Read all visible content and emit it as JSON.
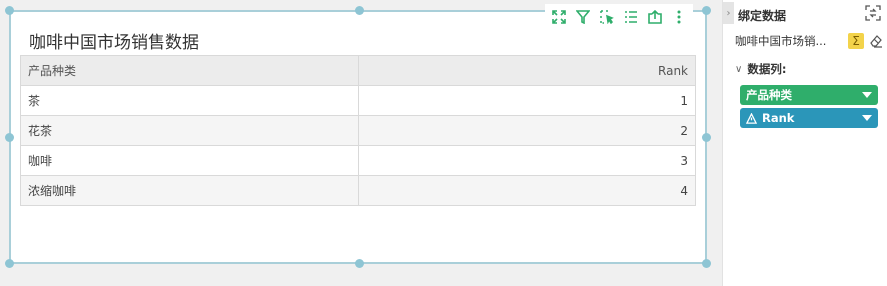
{
  "widget": {
    "title": "咖啡中国市场销售数据",
    "toolbar_icons": [
      "expand-icon",
      "filter-icon",
      "select-icon",
      "list-icon",
      "export-icon",
      "more-icon"
    ]
  },
  "table": {
    "columns": [
      "产品种类",
      "Rank"
    ],
    "rows": [
      [
        "茶",
        "1"
      ],
      [
        "花茶",
        "2"
      ],
      [
        "咖啡",
        "3"
      ],
      [
        "浓缩咖啡",
        "4"
      ]
    ]
  },
  "panel": {
    "title": "绑定数据",
    "source_name": "咖啡中国市场销...",
    "sigma_symbol": "Σ",
    "section_label": "数据列:",
    "fields": [
      {
        "label": "产品种类",
        "color": "#2fae6b"
      },
      {
        "label": "Rank",
        "color": "#2b96b9"
      }
    ]
  },
  "colors": {
    "accent_green": "#2fae6b",
    "accent_blue": "#2b96b9",
    "selection_border": "#a9cfd9",
    "sigma_yellow": "#f3d34a"
  }
}
